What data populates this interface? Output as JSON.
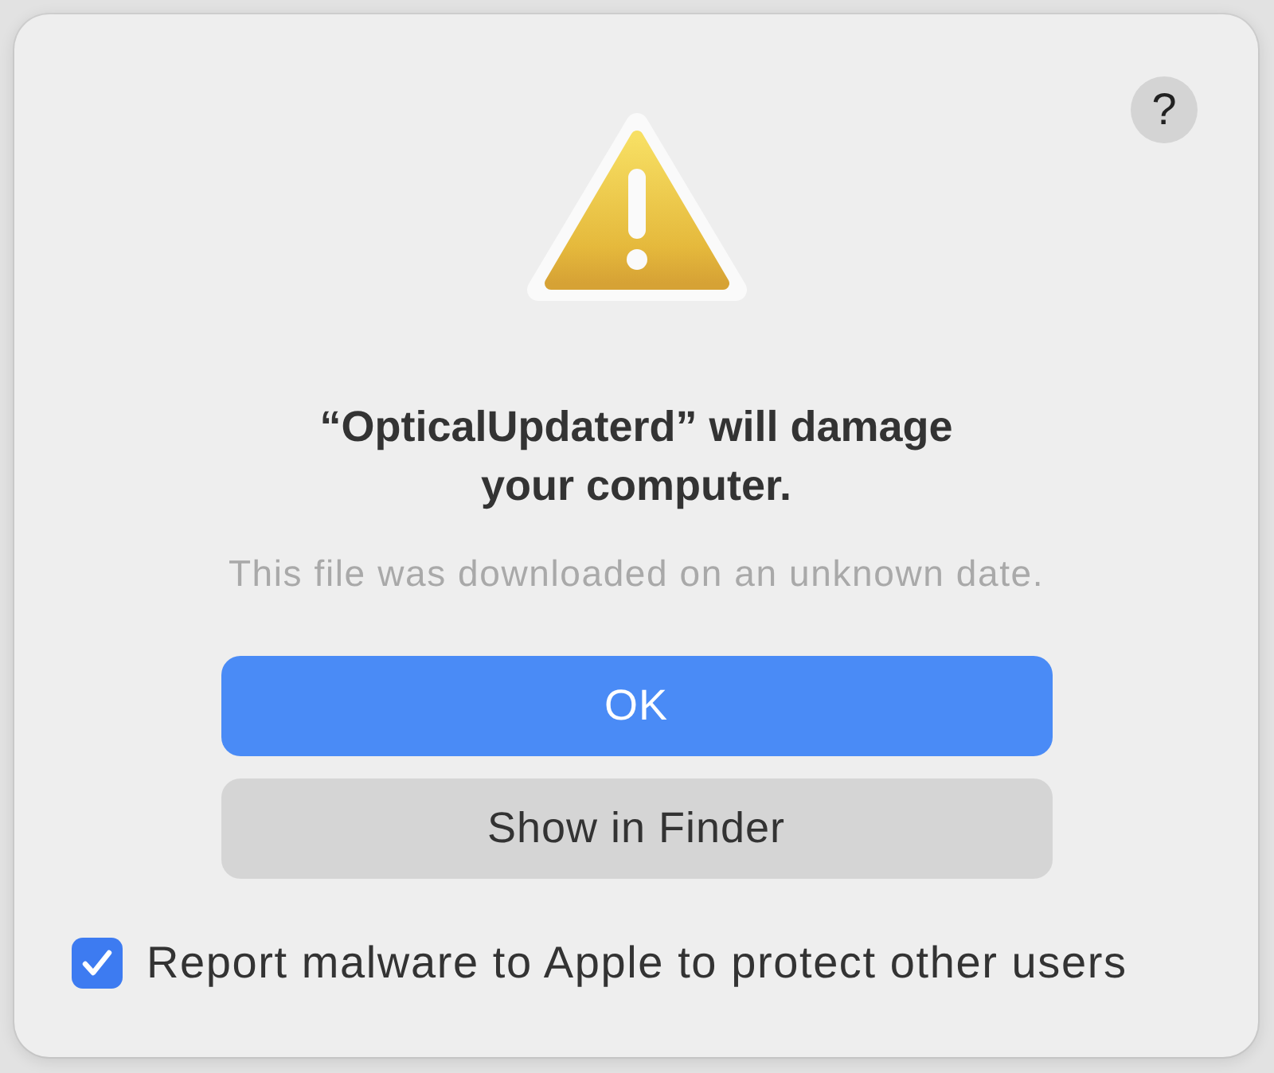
{
  "dialog": {
    "help_button": "?",
    "title": "“OpticalUpdaterd” will damage your computer.",
    "message": "This file was downloaded on an unknown date.",
    "buttons": [
      {
        "label": "OK",
        "kind": "primary"
      },
      {
        "label": "Show in Finder",
        "kind": "secondary"
      }
    ],
    "checkbox": {
      "label": "Report malware to Apple to protect other users",
      "checked": true
    }
  }
}
